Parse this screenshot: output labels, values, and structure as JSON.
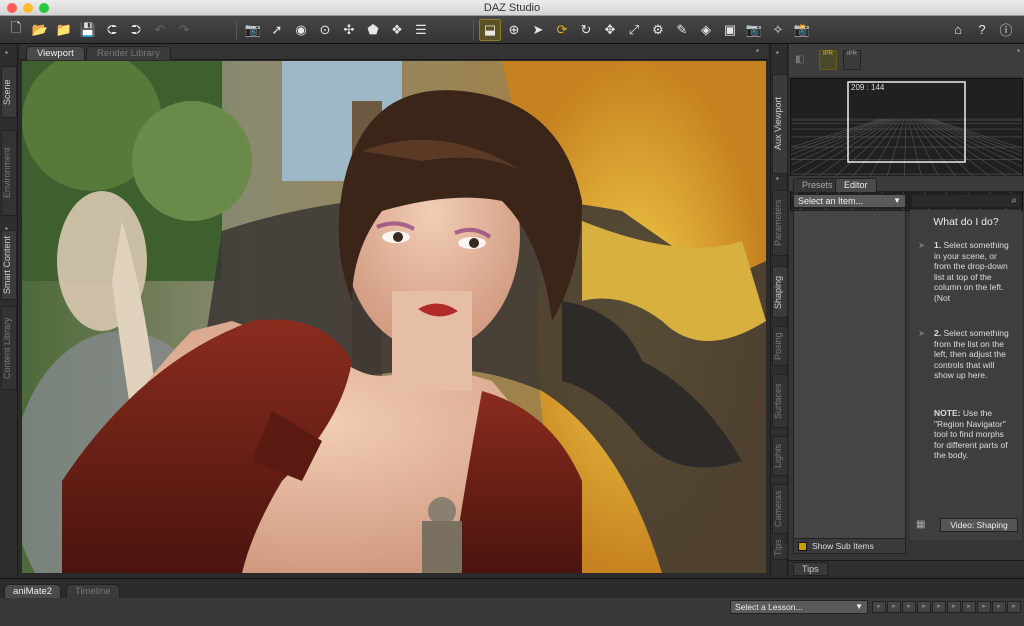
{
  "window": {
    "title": "DAZ Studio",
    "traffic_lights": {
      "close": "#ff5f57",
      "minimize": "#febc2e",
      "zoom": "#28c840"
    }
  },
  "toolbar": {
    "file_icons": [
      {
        "name": "new-file-icon",
        "glyph": "🗋"
      },
      {
        "name": "open-icon",
        "glyph": "📂"
      },
      {
        "name": "merge-icon",
        "glyph": "📁"
      },
      {
        "name": "save-icon",
        "glyph": "💾"
      },
      {
        "name": "import-icon",
        "glyph": "⮈"
      },
      {
        "name": "export-icon",
        "glyph": "⮊"
      },
      {
        "name": "undo-icon",
        "glyph": "↶"
      },
      {
        "name": "redo-icon",
        "glyph": "↷"
      }
    ],
    "create_icons": [
      {
        "name": "new-camera-icon",
        "glyph": "📷"
      },
      {
        "name": "new-distant-light-icon",
        "glyph": "➚"
      },
      {
        "name": "new-spotlight-icon",
        "glyph": "◉"
      },
      {
        "name": "new-point-light-icon",
        "glyph": "⊙"
      },
      {
        "name": "new-null-icon",
        "glyph": "✣"
      },
      {
        "name": "new-primitive-icon",
        "glyph": "⬟"
      },
      {
        "name": "new-group-icon",
        "glyph": "❖"
      },
      {
        "name": "render-settings-icon",
        "glyph": "☰"
      }
    ],
    "tool_icons": [
      {
        "name": "universal-tool-icon",
        "glyph": "⬓",
        "active": true
      },
      {
        "name": "node-selection-icon",
        "glyph": "⊕"
      },
      {
        "name": "pointer-tool-icon",
        "glyph": "➤"
      },
      {
        "name": "active-pose-icon",
        "glyph": "⟳",
        "gold": true
      },
      {
        "name": "rotate-tool-icon",
        "glyph": "↻"
      },
      {
        "name": "translate-tool-icon",
        "glyph": "✥"
      },
      {
        "name": "scale-tool-icon",
        "glyph": "⤢"
      },
      {
        "name": "joint-editor-icon",
        "glyph": "⚙"
      },
      {
        "name": "geometry-editor-icon",
        "glyph": "✎"
      },
      {
        "name": "surface-selection-icon",
        "glyph": "◈"
      },
      {
        "name": "spot-render-icon",
        "glyph": "▣"
      },
      {
        "name": "camera-snapshot-icon",
        "glyph": "📷"
      },
      {
        "name": "region-navigator-icon",
        "glyph": "✧"
      },
      {
        "name": "render-icon",
        "glyph": "📸"
      }
    ],
    "right_icons": [
      {
        "name": "home-icon",
        "glyph": "⌂"
      },
      {
        "name": "whats-this-icon",
        "glyph": "?"
      },
      {
        "name": "help-icon",
        "glyph": "ⓘ"
      }
    ]
  },
  "left_tabs": [
    {
      "label": "Scene",
      "active": true
    },
    {
      "label": "Environment",
      "active": false
    },
    {
      "label": "Smart Content",
      "active": true
    },
    {
      "label": "Content Library",
      "active": false
    }
  ],
  "main_tabs": [
    {
      "label": "Viewport",
      "active": true
    },
    {
      "label": "Render Library",
      "active": false
    }
  ],
  "right_tabs": [
    {
      "label": "Aux Viewport"
    },
    {
      "label": "Parameters"
    },
    {
      "label": "Shaping"
    },
    {
      "label": "Posing"
    },
    {
      "label": "Surfaces"
    },
    {
      "label": "Lights"
    },
    {
      "label": "Cameras"
    },
    {
      "label": "Tips"
    }
  ],
  "aux_viewport": {
    "resolution": "209 : 144",
    "toggles": [
      "IPR",
      "IPR"
    ]
  },
  "shaping": {
    "tabs": [
      {
        "label": "Presets",
        "active": false
      },
      {
        "label": "Editor",
        "active": true
      }
    ],
    "select_item": "Select an Item...",
    "show_sub_items": "Show Sub Items",
    "help_title": "What do I do?",
    "steps": [
      {
        "num": "1.",
        "text": "Select something in your scene, or from the drop-down list at top of the column on the left. (Not"
      },
      {
        "num": "2.",
        "text": "Select something from the list on the left, then adjust the controls that will show up here."
      }
    ],
    "note_label": "NOTE:",
    "note_text": "Use the \"Region Navigator\" tool to find morphs for different parts of the body.",
    "video_button": "Video: Shaping"
  },
  "tips_tab": "Tips",
  "bottom": {
    "tabs": [
      {
        "label": "aniMate2",
        "active": true
      },
      {
        "label": "Timeline",
        "active": false
      }
    ],
    "lesson_select": "Select a Lesson..."
  }
}
